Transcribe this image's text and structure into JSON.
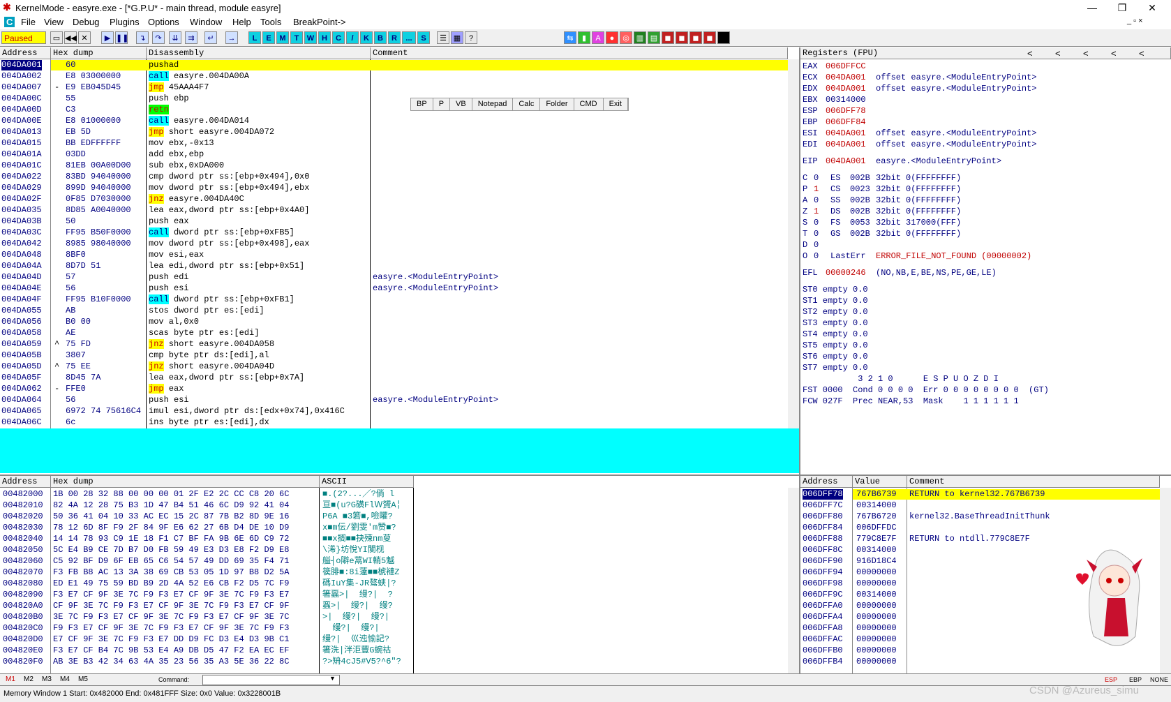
{
  "window": {
    "title": "KernelMode - easyre.exe - [*G.P.U* - main thread, module easyre]",
    "minimize": "—",
    "maximize": "❐",
    "close": "✕"
  },
  "menu": [
    "C",
    "File",
    "View",
    "Debug",
    "Plugins",
    "Options",
    "Window",
    "Help",
    "Tools",
    "BreakPoint->"
  ],
  "menu_right": "_ ▫ ×",
  "toolbar": {
    "status": "Paused",
    "letters": [
      "L",
      "E",
      "M",
      "T",
      "W",
      "H",
      "C",
      "/",
      "K",
      "B",
      "R",
      "...",
      "S"
    ]
  },
  "disasm": {
    "headers": [
      "Address",
      "Hex dump",
      "Disassembly",
      "Comment"
    ],
    "rows": [
      {
        "addr": "004DA001",
        "mark": "",
        "hex": "60",
        "ins": "",
        "op": "pushad",
        "comment": "",
        "sel": true
      },
      {
        "addr": "004DA002",
        "mark": "",
        "hex": "E8 03000000",
        "ins": "call",
        "op": " easyre.004DA00A",
        "comment": ""
      },
      {
        "addr": "004DA007",
        "mark": "-",
        "hex": "E9 EB045D45",
        "ins": "jmp",
        "op": " 45AAA4F7",
        "comment": ""
      },
      {
        "addr": "004DA00C",
        "mark": "",
        "hex": "55",
        "ins": "",
        "op": "push ebp",
        "comment": ""
      },
      {
        "addr": "004DA00D",
        "mark": "",
        "hex": "C3",
        "ins": "retn",
        "op": "",
        "comment": ""
      },
      {
        "addr": "004DA00E",
        "mark": "",
        "hex": "E8 01000000",
        "ins": "call",
        "op": " easyre.004DA014",
        "comment": ""
      },
      {
        "addr": "004DA013",
        "mark": "",
        "hex": "EB 5D",
        "ins": "jmp",
        "op": " short easyre.004DA072",
        "comment": ""
      },
      {
        "addr": "004DA015",
        "mark": "",
        "hex": "BB EDFFFFFF",
        "ins": "",
        "op": "mov ebx,-0x13",
        "comment": ""
      },
      {
        "addr": "004DA01A",
        "mark": "",
        "hex": "03DD",
        "ins": "",
        "op": "add ebx,ebp",
        "comment": ""
      },
      {
        "addr": "004DA01C",
        "mark": "",
        "hex": "81EB 00A00D00",
        "ins": "",
        "op": "sub ebx,0xDA000",
        "comment": ""
      },
      {
        "addr": "004DA022",
        "mark": "",
        "hex": "83BD 94040000",
        "ins": "",
        "op": "cmp dword ptr ss:[ebp+0x494],0x0",
        "comment": ""
      },
      {
        "addr": "004DA029",
        "mark": "",
        "hex": "899D 94040000",
        "ins": "",
        "op": "mov dword ptr ss:[ebp+0x494],ebx",
        "comment": ""
      },
      {
        "addr": "004DA02F",
        "mark": "",
        "hex": "0F85 D7030000",
        "ins": "jnz",
        "op": " easyre.004DA40C",
        "comment": ""
      },
      {
        "addr": "004DA035",
        "mark": "",
        "hex": "8D85 A0040000",
        "ins": "",
        "op": "lea eax,dword ptr ss:[ebp+0x4A0]",
        "comment": ""
      },
      {
        "addr": "004DA03B",
        "mark": "",
        "hex": "50",
        "ins": "",
        "op": "push eax",
        "comment": ""
      },
      {
        "addr": "004DA03C",
        "mark": "",
        "hex": "FF95 B50F0000",
        "ins": "call",
        "op": " dword ptr ss:[ebp+0xFB5]",
        "comment": ""
      },
      {
        "addr": "004DA042",
        "mark": "",
        "hex": "8985 98040000",
        "ins": "",
        "op": "mov dword ptr ss:[ebp+0x498],eax",
        "comment": ""
      },
      {
        "addr": "004DA048",
        "mark": "",
        "hex": "8BF0",
        "ins": "",
        "op": "mov esi,eax",
        "comment": ""
      },
      {
        "addr": "004DA04A",
        "mark": "",
        "hex": "8D7D 51",
        "ins": "",
        "op": "lea edi,dword ptr ss:[ebp+0x51]",
        "comment": ""
      },
      {
        "addr": "004DA04D",
        "mark": "",
        "hex": "57",
        "ins": "",
        "op": "push edi",
        "comment": "easyre.<ModuleEntryPoint>"
      },
      {
        "addr": "004DA04E",
        "mark": "",
        "hex": "56",
        "ins": "",
        "op": "push esi",
        "comment": "easyre.<ModuleEntryPoint>"
      },
      {
        "addr": "004DA04F",
        "mark": "",
        "hex": "FF95 B10F0000",
        "ins": "call",
        "op": " dword ptr ss:[ebp+0xFB1]",
        "comment": ""
      },
      {
        "addr": "004DA055",
        "mark": "",
        "hex": "AB",
        "ins": "",
        "op": "stos dword ptr es:[edi]",
        "comment": ""
      },
      {
        "addr": "004DA056",
        "mark": "",
        "hex": "B0 00",
        "ins": "",
        "op": "mov al,0x0",
        "comment": ""
      },
      {
        "addr": "004DA058",
        "mark": "",
        "hex": "AE",
        "ins": "",
        "op": "scas byte ptr es:[edi]",
        "comment": ""
      },
      {
        "addr": "004DA059",
        "mark": "^",
        "hex": "75 FD",
        "ins": "jnz",
        "op": " short easyre.004DA058",
        "comment": ""
      },
      {
        "addr": "004DA05B",
        "mark": "",
        "hex": "3807",
        "ins": "",
        "op": "cmp byte ptr ds:[edi],al",
        "comment": ""
      },
      {
        "addr": "004DA05D",
        "mark": "^",
        "hex": "75 EE",
        "ins": "jnz",
        "op": " short easyre.004DA04D",
        "comment": ""
      },
      {
        "addr": "004DA05F",
        "mark": "",
        "hex": "8D45 7A",
        "ins": "",
        "op": "lea eax,dword ptr ss:[ebp+0x7A]",
        "comment": ""
      },
      {
        "addr": "004DA062",
        "mark": "-",
        "hex": "FFE0",
        "ins": "jmp",
        "op": " eax",
        "comment": ""
      },
      {
        "addr": "004DA064",
        "mark": "",
        "hex": "56",
        "ins": "",
        "op": "push esi",
        "comment": "easyre.<ModuleEntryPoint>"
      },
      {
        "addr": "004DA065",
        "mark": "",
        "hex": "6972 74 75616C4",
        "ins": "",
        "op": "imul esi,dword ptr ds:[edx+0x74],0x416C",
        "comment": ""
      },
      {
        "addr": "004DA06C",
        "mark": "",
        "hex": "6c",
        "ins": "",
        "op": "ins byte ptr es:[edi],dx",
        "comment": ""
      }
    ]
  },
  "plugin_buttons": [
    "BP",
    "P",
    "VB",
    "Notepad",
    "Calc",
    "Folder",
    "CMD",
    "Exit"
  ],
  "registers": {
    "header": "Registers (FPU)",
    "nav": [
      "<",
      "<",
      "<",
      "<",
      "<"
    ],
    "gpr": [
      {
        "name": "EAX",
        "val": "006DFFCC",
        "note": ""
      },
      {
        "name": "ECX",
        "val": "004DA001",
        "note": "offset easyre.<ModuleEntryPoint>"
      },
      {
        "name": "EDX",
        "val": "004DA001",
        "note": "offset easyre.<ModuleEntryPoint>"
      },
      {
        "name": "EBX",
        "val": "00314000",
        "note": ""
      },
      {
        "name": "ESP",
        "val": "006DFF78",
        "note": ""
      },
      {
        "name": "EBP",
        "val": "006DFF84",
        "note": ""
      },
      {
        "name": "ESI",
        "val": "004DA001",
        "note": "offset easyre.<ModuleEntryPoint>"
      },
      {
        "name": "EDI",
        "val": "004DA001",
        "note": "offset easyre.<ModuleEntryPoint>"
      }
    ],
    "eip": {
      "name": "EIP",
      "val": "004DA001",
      "note": "easyre.<ModuleEntryPoint>"
    },
    "flags": [
      {
        "f": "C",
        "v": "0",
        "seg": "ES",
        "sel": "002B",
        "bits": "32bit",
        "range": "0(FFFFFFFF)"
      },
      {
        "f": "P",
        "v": "1",
        "seg": "CS",
        "sel": "0023",
        "bits": "32bit",
        "range": "0(FFFFFFFF)"
      },
      {
        "f": "A",
        "v": "0",
        "seg": "SS",
        "sel": "002B",
        "bits": "32bit",
        "range": "0(FFFFFFFF)"
      },
      {
        "f": "Z",
        "v": "1",
        "seg": "DS",
        "sel": "002B",
        "bits": "32bit",
        "range": "0(FFFFFFFF)"
      },
      {
        "f": "S",
        "v": "0",
        "seg": "FS",
        "sel": "0053",
        "bits": "32bit",
        "range": "317000(FFF)"
      },
      {
        "f": "T",
        "v": "0",
        "seg": "GS",
        "sel": "002B",
        "bits": "32bit",
        "range": "0(FFFFFFFF)"
      },
      {
        "f": "D",
        "v": "0",
        "seg": "",
        "sel": "",
        "bits": "",
        "range": ""
      },
      {
        "f": "O",
        "v": "0",
        "seg": "LastErr",
        "sel": "",
        "bits": "",
        "range": "ERROR_FILE_NOT_FOUND (00000002)"
      }
    ],
    "efl": {
      "name": "EFL",
      "val": "00000246",
      "note": "(NO,NB,E,BE,NS,PE,GE,LE)"
    },
    "fpu": [
      "ST0 empty 0.0",
      "ST1 empty 0.0",
      "ST2 empty 0.0",
      "ST3 empty 0.0",
      "ST4 empty 0.0",
      "ST5 empty 0.0",
      "ST6 empty 0.0",
      "ST7 empty 0.0"
    ],
    "fpu_hdr": "           3 2 1 0      E S P U O Z D I",
    "fst": "FST 0000  Cond 0 0 0 0  Err 0 0 0 0 0 0 0 0  (GT)",
    "fcw": "FCW 027F  Prec NEAR,53  Mask    1 1 1 1 1 1"
  },
  "dump": {
    "headers": [
      "Address",
      "Hex dump",
      "ASCII"
    ],
    "rows": [
      {
        "addr": "00482000",
        "hex": "1B 00 28 32 88 00 00 00 01 2F E2 2C CC C8 20 6C",
        "ascii": "■.(2?...╱?倘 l"
      },
      {
        "addr": "00482010",
        "hex": "82 4A 12 28 75 B3 1D 47 B4 51 46 6C D9 92 41 04",
        "ascii": "亘■(u?G磺FlＷ贇A╎"
      },
      {
        "addr": "00482020",
        "hex": "50 36 41 04 10 33 AC EC 15 2C 87 7B B2 8D 9E 16",
        "ascii": "P6A ■3箬■,噞矔?"
      },
      {
        "addr": "00482030",
        "hex": "78 12 6D 8F F9 2F 84 9F E6 62 27 6B D4 DE 10 D9",
        "ascii": "x■m伝/劉雯'm赞■?"
      },
      {
        "addr": "00482040",
        "hex": "14 14 78 93 C9 1E 18 F1 C7 BF FA 9B 6E 6D C9 72",
        "ascii": "■■x搁■■抉殐nm蓃"
      },
      {
        "addr": "00482050",
        "hex": "5C E4 B9 CE 7D B7 D0 FB 59 49 E3 D3 E8 F2 D9 E8",
        "ascii": "\\浠}坊悅YI闃枧"
      },
      {
        "addr": "00482060",
        "hex": "C5 92 BF D9 6F EB 65 C6 54 57 49 DD 69 35 F4 71",
        "ascii": "艗┤o隦e蒚WI輎5魆"
      },
      {
        "addr": "00482070",
        "hex": "F3 FB B8 AC 13 3A 38 69 CB 53 05 1D 97 B8 D2 5A",
        "ascii": "篌腓■:8i薘■■椃褳Z"
      },
      {
        "addr": "00482080",
        "hex": "ED E1 49 75 59 BD B9 2D 4A 52 E6 CB F2 D5 7C F9",
        "ascii": "碼IuY集-JR骜蛱|?"
      },
      {
        "addr": "00482090",
        "hex": "F3 E7 CF 9F 3E 7C F9 F3 E7 CF 9F 3E 7C F9 F3 E7",
        "ascii": "箸蠠>|  缦?|  ?"
      },
      {
        "addr": "004820A0",
        "hex": "CF 9F 3E 7C F9 F3 E7 CF 9F 3E 7C F9 F3 E7 CF 9F",
        "ascii": "蠠>|  缦?|  缦?"
      },
      {
        "addr": "004820B0",
        "hex": "3E 7C F9 F3 E7 CF 9F 3E 7C F9 F3 E7 CF 9F 3E 7C",
        "ascii": ">|  缦?|  缦?|"
      },
      {
        "addr": "004820C0",
        "hex": "F9 F3 E7 CF 9F 3E 7C F9 F3 E7 CF 9F 3E 7C F9 F3",
        "ascii": "  缦?|  缦?|"
      },
      {
        "addr": "004820D0",
        "hex": "E7 CF 9F 3E 7C F9 F3 E7 DD D9 FC D3 E4 D3 9B C1",
        "ascii": "缦?|  巛迍愉記?"
      },
      {
        "addr": "004820E0",
        "hex": "F3 E7 CF B4 7C 9B 53 E4 A9 DB D5 47 F2 EA EC EF",
        "ascii": "箸洗|泮洰豐G蜿祜"
      },
      {
        "addr": "004820F0",
        "hex": "AB 3E B3 42 34 63 4A 35 23 56 35 A3 5E 36 22 8C",
        "ascii": "?>矪4cJ5#V5?^6\"?"
      }
    ]
  },
  "stack": {
    "headers": [
      "Address",
      "Value",
      "Comment"
    ],
    "rows": [
      {
        "addr": "006DFF78",
        "val": "767B6739",
        "comment": "RETURN to kernel32.767B6739",
        "sel": true
      },
      {
        "addr": "006DFF7C",
        "val": "00314000",
        "comment": ""
      },
      {
        "addr": "006DFF80",
        "val": "767B6720",
        "comment": "kernel32.BaseThreadInitThunk"
      },
      {
        "addr": "006DFF84",
        "val": "006DFFDC",
        "comment": ""
      },
      {
        "addr": "006DFF88",
        "val": "779C8E7F",
        "comment": "RETURN to ntdll.779C8E7F"
      },
      {
        "addr": "006DFF8C",
        "val": "00314000",
        "comment": ""
      },
      {
        "addr": "006DFF90",
        "val": "916D18C4",
        "comment": ""
      },
      {
        "addr": "006DFF94",
        "val": "00000000",
        "comment": ""
      },
      {
        "addr": "006DFF98",
        "val": "00000000",
        "comment": ""
      },
      {
        "addr": "006DFF9C",
        "val": "00314000",
        "comment": ""
      },
      {
        "addr": "006DFFA0",
        "val": "00000000",
        "comment": ""
      },
      {
        "addr": "006DFFA4",
        "val": "00000000",
        "comment": ""
      },
      {
        "addr": "006DFFA8",
        "val": "00000000",
        "comment": ""
      },
      {
        "addr": "006DFFAC",
        "val": "00000000",
        "comment": ""
      },
      {
        "addr": "006DFFB0",
        "val": "00000000",
        "comment": ""
      },
      {
        "addr": "006DFFB4",
        "val": "00000000",
        "comment": ""
      }
    ]
  },
  "command_bar": {
    "tabs": [
      "M1",
      "M2",
      "M3",
      "M4",
      "M5"
    ],
    "command_label": "Command:",
    "right": [
      "ESP",
      "EBP",
      "NONE"
    ]
  },
  "status": "Memory Window 1  Start: 0x482000  End: 0x481FFF  Size: 0x0  Value: 0x3228001B",
  "watermark": "CSDN @Azureus_simu"
}
